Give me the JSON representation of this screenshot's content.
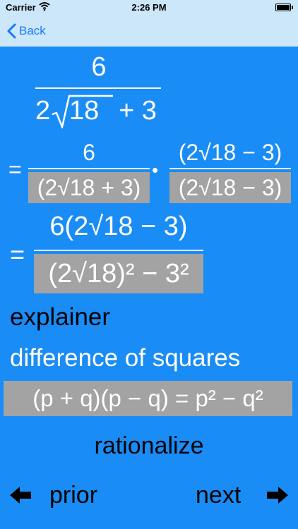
{
  "status": {
    "carrier": "Carrier",
    "time": "2:26 PM"
  },
  "nav": {
    "back_label": "Back"
  },
  "expr": {
    "line1_num": "6",
    "line1_den_a": "2",
    "line1_den_rad": "18",
    "line1_den_b": "+ 3",
    "eq": "=",
    "dot": "•",
    "line2_num": "6",
    "line2_den": "(2√18 + 3)",
    "line2_factor_num": "(2√18 − 3)",
    "line2_factor_den": "(2√18 − 3)",
    "line3_num": "6(2√18 − 3)",
    "line3_den": "(2√18)² − 3²"
  },
  "explainer_label": "explainer",
  "explainer_text": "difference of squares",
  "formula": "(p + q)(p − q) = p² − q²",
  "buttons": {
    "rationalize": "rationalize",
    "prior": "prior",
    "next": "next"
  }
}
